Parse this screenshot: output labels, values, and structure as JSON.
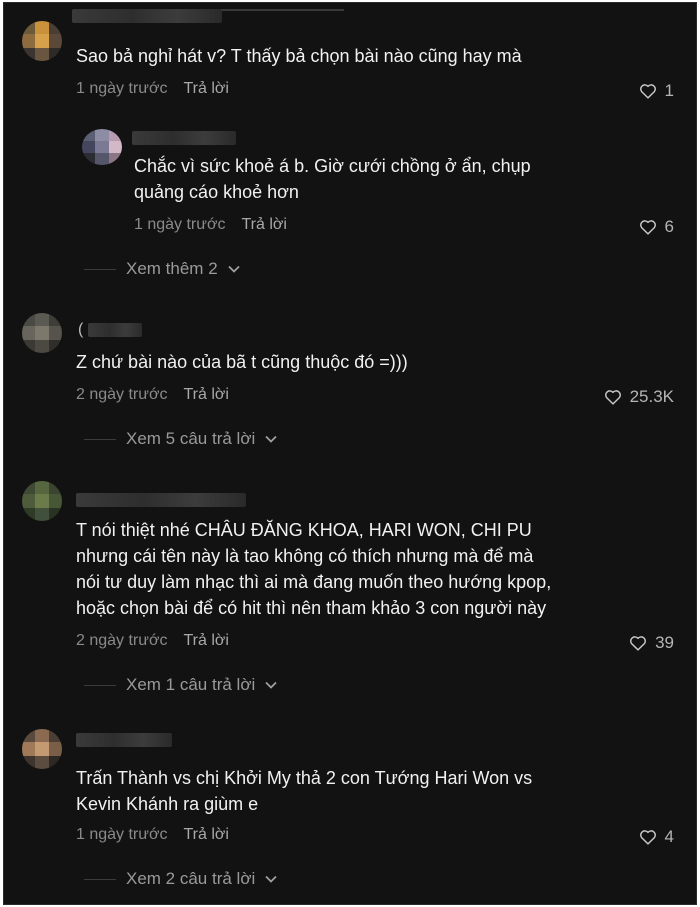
{
  "comments": [
    {
      "text_lines": [
        "Sao bả nghỉ hát v? T thấy bả chọn bài nào cũng hay mà"
      ],
      "time": "1 ngày trước",
      "reply_label": "Trả lời",
      "likes": "1",
      "replies": [
        {
          "text_lines": [
            "Chắc vì sức khoẻ á b. Giờ cưới chồng ở ẩn, chụp",
            "quảng cáo khoẻ hơn"
          ],
          "time": "1 ngày trước",
          "reply_label": "Trả lời",
          "likes": "6"
        }
      ],
      "more_label": "Xem thêm 2"
    },
    {
      "name_fragment": "(",
      "text_lines": [
        "Z chứ bài nào của bã t cũng thuộc đó =)))"
      ],
      "time": "2 ngày trước",
      "reply_label": "Trả lời",
      "likes": "25.3K",
      "more_label": "Xem 5 câu trả lời"
    },
    {
      "text_lines": [
        "T nói thiệt nhé CHÂU ĐĂNG KHOA, HARI WON, CHI PU",
        "nhưng cái tên này là tao không có thích nhưng mà để mà",
        "nói tư duy làm nhạc thì ai mà đang muốn theo hướng kpop,",
        "hoặc chọn bài để có hit thì nên tham khảo 3 con người này"
      ],
      "time": "2 ngày trước",
      "reply_label": "Trả lời",
      "likes": "39",
      "more_label": "Xem 1 câu trả lời"
    },
    {
      "text_lines": [
        "Trấn Thành vs chị Khởi My thả 2 con Tướng Hari Won vs",
        "Kevin Khánh ra giùm e"
      ],
      "time": "1 ngày trước",
      "reply_label": "Trả lời",
      "likes": "4",
      "more_label": "Xem 2 câu trả lời"
    }
  ],
  "icons": {
    "like": "heart-outline-icon",
    "expand": "chevron-down-icon"
  },
  "colors": {
    "background": "#121212",
    "text": "#f1f1f1",
    "meta": "#8a8a8a"
  }
}
